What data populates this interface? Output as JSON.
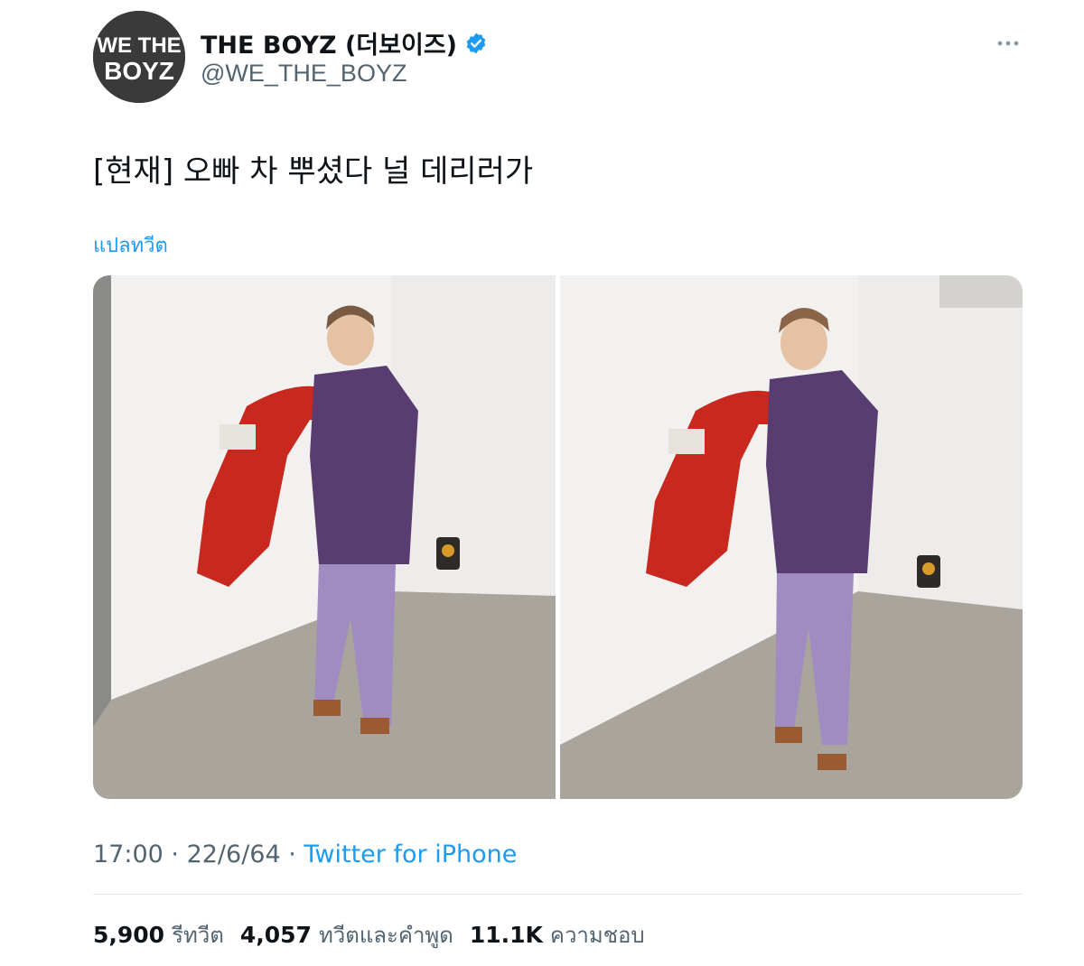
{
  "user": {
    "display_name": "THE BOYZ (더보이즈)",
    "handle": "@WE_THE_BOYZ",
    "avatar_text_top": "WE THE",
    "avatar_text_bottom": "BOYZ",
    "verified": true
  },
  "tweet": {
    "text": "[현재] 오빠 차 뿌셨다 널 데리러가",
    "translate_label": "แปลทวีต"
  },
  "meta": {
    "time": "17:00",
    "separator": " · ",
    "date": "22/6/64",
    "source": "Twitter for iPhone"
  },
  "stats": {
    "retweets_value": "5,900",
    "retweets_label": "รีทวีต",
    "quotes_value": "4,057",
    "quotes_label": "ทวีตและคำพูด",
    "likes_value": "11.1K",
    "likes_label": "ความชอบ"
  },
  "colors": {
    "accent": "#1d9bf0",
    "secondary_text": "#536471",
    "primary_text": "#0f1419",
    "car_door": "#c8281e",
    "suit": "#5a3d70",
    "trousers": "#a08cc0"
  },
  "icons": {
    "verified": "verified-badge-icon",
    "more": "more-horizontal-icon"
  }
}
